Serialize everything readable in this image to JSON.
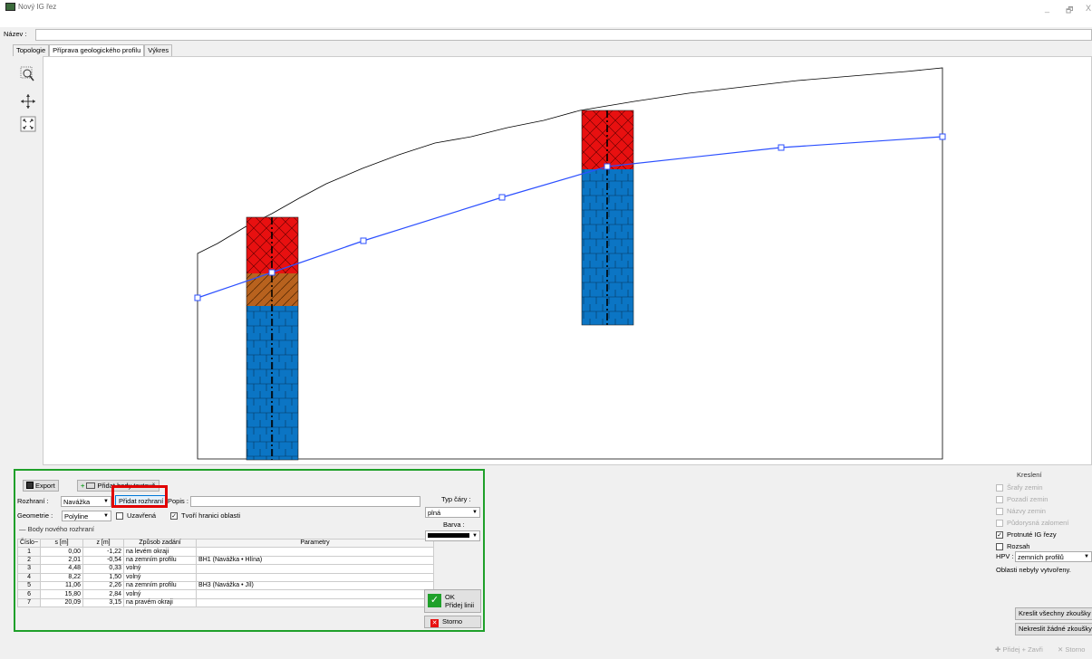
{
  "window": {
    "title": "Nový IG řez",
    "minimize": "_",
    "maximize": "🗗",
    "close": "X"
  },
  "name_row": {
    "label": "Název :",
    "value": ""
  },
  "tabs": [
    "Topologie",
    "Příprava geologického profilu",
    "Výkres"
  ],
  "toolbar": {
    "icons": [
      "zoom-window-icon",
      "pan-icon",
      "fit-all-icon"
    ]
  },
  "panel": {
    "export_label": "Export",
    "add_text_points_label": "Přidat body textově",
    "rozhrani_label": "Rozhraní :",
    "rozhrani_value": "Navážka",
    "add_interface_label": "Přidat rozhraní",
    "popis_label": "Popis :",
    "popis_value": "",
    "geometrie_label": "Geometrie :",
    "geometrie_value": "Polyline",
    "uzavrena_label": "Uzavřená",
    "uzavrena_checked": false,
    "tvori_label": "Tvoří hranici oblasti",
    "tvori_checked": true,
    "group_label": "Body nového rozhraní",
    "typ_cary_label": "Typ čáry :",
    "typ_cary_value": "plná",
    "barva_label": "Barva :",
    "ok_label": "OK",
    "ok_sub": "Přidej linii",
    "cancel_label": "Storno"
  },
  "table": {
    "headers": [
      "Číslo",
      "s [m]",
      "z [m]",
      "Způsob zadání",
      "Parametry"
    ],
    "rows": [
      [
        "1",
        "0,00",
        "-1,22",
        "na levém okraji",
        ""
      ],
      [
        "2",
        "2,01",
        "-0,54",
        "na zemním profilu",
        "BH1 (Navážka • Hlína)"
      ],
      [
        "3",
        "4,48",
        "0,33",
        "volný",
        ""
      ],
      [
        "4",
        "8,22",
        "1,50",
        "volný",
        ""
      ],
      [
        "5",
        "11,06",
        "2,26",
        "na zemním profilu",
        "BH3 (Navážka • Jíl)"
      ],
      [
        "6",
        "15,80",
        "2,84",
        "volný",
        ""
      ],
      [
        "7",
        "20,09",
        "3,15",
        "na pravém okraji",
        ""
      ]
    ]
  },
  "right_panel": {
    "group_label": "Kreslení",
    "items": [
      {
        "label": "Šrafy zemin",
        "checked": false,
        "enabled": false
      },
      {
        "label": "Pozadí zemin",
        "checked": false,
        "enabled": false
      },
      {
        "label": "Názvy zemin",
        "checked": false,
        "enabled": false
      },
      {
        "label": "Půdorysná zalomení",
        "checked": false,
        "enabled": false
      },
      {
        "label": "Protnuté IG řezy",
        "checked": true,
        "enabled": true
      },
      {
        "label": "Rozsah",
        "checked": false,
        "enabled": true
      }
    ],
    "hpv_label": "HPV :",
    "hpv_value": "zemních profilů",
    "status": "Oblasti nebyly vytvořeny.",
    "draw_all_label": "Kreslit všechny zkoušky",
    "draw_none_label": "Nekreslit žádné zkoušky"
  },
  "footer": {
    "add_close_label": "Přidej + Zavři",
    "cancel_label": "Storno"
  },
  "colors": {
    "accent_green": "#1fa02a",
    "highlight_red": "#e10000",
    "line_blue": "#2b4fff",
    "soil_red": "#e81010",
    "soil_orange": "#b8621e",
    "soil_blue": "#0b75c4"
  }
}
